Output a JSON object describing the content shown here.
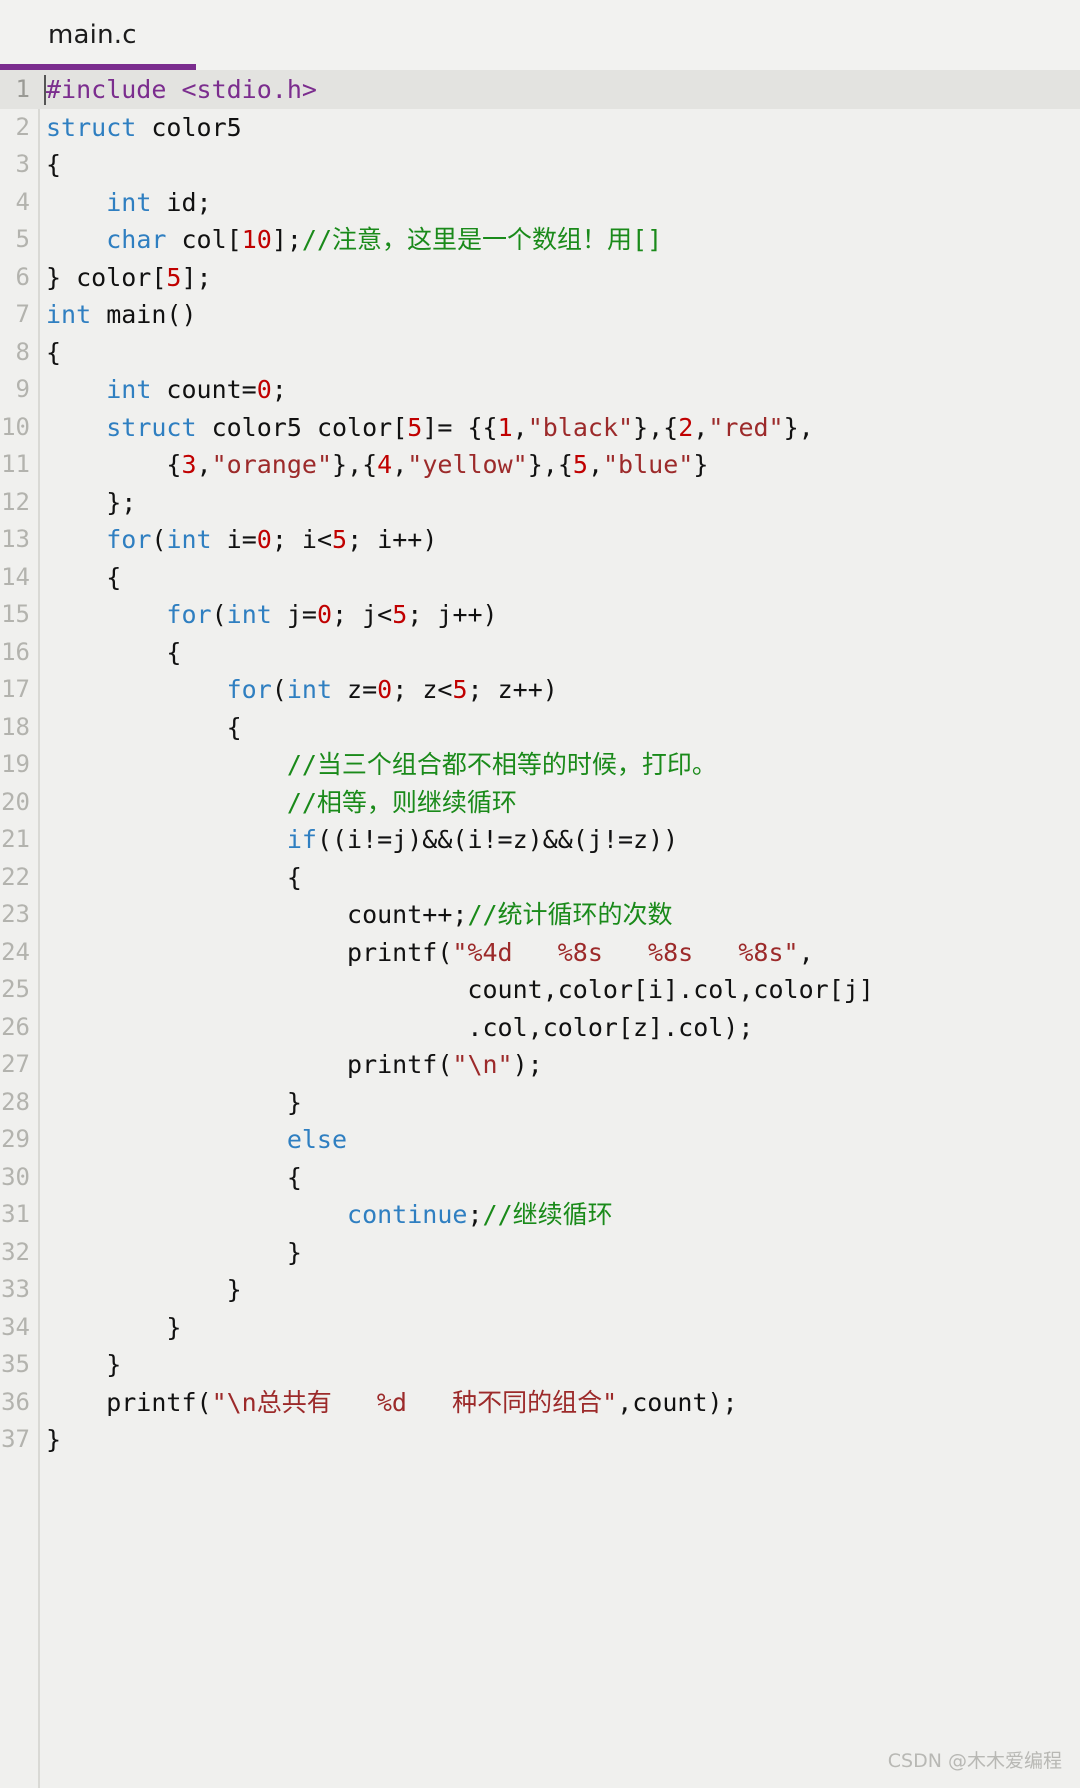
{
  "tab": {
    "label": "main.c",
    "accent_color": "#7b2d8e"
  },
  "editor": {
    "background_color": "#f0f0ee",
    "current_line": 1,
    "total_lines": 37,
    "colors": {
      "keyword": "#2f7fc1",
      "preprocessor": "#7b2d8e",
      "string": "#9c2a2a",
      "number": "#c00000",
      "comment": "#1a8a1a",
      "plain": "#111111",
      "gutter_text": "#b3b3ae"
    },
    "lines": [
      {
        "n": "1",
        "tokens": [
          {
            "t": "pre",
            "v": "#include <stdio.h>"
          }
        ]
      },
      {
        "n": "2",
        "tokens": [
          {
            "t": "kw",
            "v": "struct"
          },
          {
            "t": "pl",
            "v": " color5"
          }
        ]
      },
      {
        "n": "3",
        "tokens": [
          {
            "t": "pl",
            "v": "{"
          }
        ]
      },
      {
        "n": "4",
        "tokens": [
          {
            "t": "pl",
            "v": "    "
          },
          {
            "t": "kw",
            "v": "int"
          },
          {
            "t": "pl",
            "v": " id;"
          }
        ]
      },
      {
        "n": "5",
        "tokens": [
          {
            "t": "pl",
            "v": "    "
          },
          {
            "t": "kw",
            "v": "char"
          },
          {
            "t": "pl",
            "v": " col["
          },
          {
            "t": "num",
            "v": "10"
          },
          {
            "t": "pl",
            "v": "];"
          },
          {
            "t": "cmt",
            "v": "//注意，这里是一个数组！用[]"
          }
        ]
      },
      {
        "n": "6",
        "tokens": [
          {
            "t": "pl",
            "v": "} color["
          },
          {
            "t": "num",
            "v": "5"
          },
          {
            "t": "pl",
            "v": "];"
          }
        ]
      },
      {
        "n": "7",
        "tokens": [
          {
            "t": "kw",
            "v": "int"
          },
          {
            "t": "pl",
            "v": " main()"
          }
        ]
      },
      {
        "n": "8",
        "tokens": [
          {
            "t": "pl",
            "v": "{"
          }
        ]
      },
      {
        "n": "9",
        "tokens": [
          {
            "t": "pl",
            "v": "    "
          },
          {
            "t": "kw",
            "v": "int"
          },
          {
            "t": "pl",
            "v": " count="
          },
          {
            "t": "num",
            "v": "0"
          },
          {
            "t": "pl",
            "v": ";"
          }
        ]
      },
      {
        "n": "10",
        "tokens": [
          {
            "t": "pl",
            "v": "    "
          },
          {
            "t": "kw",
            "v": "struct"
          },
          {
            "t": "pl",
            "v": " color5 color["
          },
          {
            "t": "num",
            "v": "5"
          },
          {
            "t": "pl",
            "v": "]= {{"
          },
          {
            "t": "num",
            "v": "1"
          },
          {
            "t": "pl",
            "v": ","
          },
          {
            "t": "str",
            "v": "\"black\""
          },
          {
            "t": "pl",
            "v": "},{"
          },
          {
            "t": "num",
            "v": "2"
          },
          {
            "t": "pl",
            "v": ","
          },
          {
            "t": "str",
            "v": "\"red\""
          },
          {
            "t": "pl",
            "v": "},"
          }
        ]
      },
      {
        "n": "11",
        "tokens": [
          {
            "t": "pl",
            "v": "        {"
          },
          {
            "t": "num",
            "v": "3"
          },
          {
            "t": "pl",
            "v": ","
          },
          {
            "t": "str",
            "v": "\"orange\""
          },
          {
            "t": "pl",
            "v": "},{"
          },
          {
            "t": "num",
            "v": "4"
          },
          {
            "t": "pl",
            "v": ","
          },
          {
            "t": "str",
            "v": "\"yellow\""
          },
          {
            "t": "pl",
            "v": "},{"
          },
          {
            "t": "num",
            "v": "5"
          },
          {
            "t": "pl",
            "v": ","
          },
          {
            "t": "str",
            "v": "\"blue\""
          },
          {
            "t": "pl",
            "v": "}"
          }
        ]
      },
      {
        "n": "12",
        "tokens": [
          {
            "t": "pl",
            "v": "    };"
          }
        ]
      },
      {
        "n": "13",
        "tokens": [
          {
            "t": "pl",
            "v": "    "
          },
          {
            "t": "kw",
            "v": "for"
          },
          {
            "t": "pl",
            "v": "("
          },
          {
            "t": "kw",
            "v": "int"
          },
          {
            "t": "pl",
            "v": " i="
          },
          {
            "t": "num",
            "v": "0"
          },
          {
            "t": "pl",
            "v": "; i<"
          },
          {
            "t": "num",
            "v": "5"
          },
          {
            "t": "pl",
            "v": "; i++)"
          }
        ]
      },
      {
        "n": "14",
        "tokens": [
          {
            "t": "pl",
            "v": "    {"
          }
        ]
      },
      {
        "n": "15",
        "tokens": [
          {
            "t": "pl",
            "v": "        "
          },
          {
            "t": "kw",
            "v": "for"
          },
          {
            "t": "pl",
            "v": "("
          },
          {
            "t": "kw",
            "v": "int"
          },
          {
            "t": "pl",
            "v": " j="
          },
          {
            "t": "num",
            "v": "0"
          },
          {
            "t": "pl",
            "v": "; j<"
          },
          {
            "t": "num",
            "v": "5"
          },
          {
            "t": "pl",
            "v": "; j++)"
          }
        ]
      },
      {
        "n": "16",
        "tokens": [
          {
            "t": "pl",
            "v": "        {"
          }
        ]
      },
      {
        "n": "17",
        "tokens": [
          {
            "t": "pl",
            "v": "            "
          },
          {
            "t": "kw",
            "v": "for"
          },
          {
            "t": "pl",
            "v": "("
          },
          {
            "t": "kw",
            "v": "int"
          },
          {
            "t": "pl",
            "v": " z="
          },
          {
            "t": "num",
            "v": "0"
          },
          {
            "t": "pl",
            "v": "; z<"
          },
          {
            "t": "num",
            "v": "5"
          },
          {
            "t": "pl",
            "v": "; z++)"
          }
        ]
      },
      {
        "n": "18",
        "tokens": [
          {
            "t": "pl",
            "v": "            {"
          }
        ]
      },
      {
        "n": "19",
        "tokens": [
          {
            "t": "pl",
            "v": "                "
          },
          {
            "t": "cmt",
            "v": "//当三个组合都不相等的时候，打印。"
          }
        ]
      },
      {
        "n": "20",
        "tokens": [
          {
            "t": "pl",
            "v": "                "
          },
          {
            "t": "cmt",
            "v": "//相等，则继续循环"
          }
        ]
      },
      {
        "n": "21",
        "tokens": [
          {
            "t": "pl",
            "v": "                "
          },
          {
            "t": "kw",
            "v": "if"
          },
          {
            "t": "pl",
            "v": "((i!=j)&&(i!=z)&&(j!=z))"
          }
        ]
      },
      {
        "n": "22",
        "tokens": [
          {
            "t": "pl",
            "v": "                {"
          }
        ]
      },
      {
        "n": "23",
        "tokens": [
          {
            "t": "pl",
            "v": "                    count++;"
          },
          {
            "t": "cmt",
            "v": "//统计循环的次数"
          }
        ]
      },
      {
        "n": "24",
        "tokens": [
          {
            "t": "pl",
            "v": "                    printf("
          },
          {
            "t": "str",
            "v": "\"%4d   %8s   %8s   %8s\""
          },
          {
            "t": "pl",
            "v": ","
          }
        ]
      },
      {
        "n": "25",
        "tokens": [
          {
            "t": "pl",
            "v": "                            count,color[i].col,color[j]"
          }
        ]
      },
      {
        "n": "26",
        "tokens": [
          {
            "t": "pl",
            "v": "                            .col,color[z].col);"
          }
        ]
      },
      {
        "n": "27",
        "tokens": [
          {
            "t": "pl",
            "v": "                    printf("
          },
          {
            "t": "str",
            "v": "\"\\n\""
          },
          {
            "t": "pl",
            "v": ");"
          }
        ]
      },
      {
        "n": "28",
        "tokens": [
          {
            "t": "pl",
            "v": "                }"
          }
        ]
      },
      {
        "n": "29",
        "tokens": [
          {
            "t": "pl",
            "v": "                "
          },
          {
            "t": "kw",
            "v": "else"
          }
        ]
      },
      {
        "n": "30",
        "tokens": [
          {
            "t": "pl",
            "v": "                {"
          }
        ]
      },
      {
        "n": "31",
        "tokens": [
          {
            "t": "pl",
            "v": "                    "
          },
          {
            "t": "kw",
            "v": "continue"
          },
          {
            "t": "pl",
            "v": ";"
          },
          {
            "t": "cmt",
            "v": "//继续循环"
          }
        ]
      },
      {
        "n": "32",
        "tokens": [
          {
            "t": "pl",
            "v": "                }"
          }
        ]
      },
      {
        "n": "33",
        "tokens": [
          {
            "t": "pl",
            "v": "            }"
          }
        ]
      },
      {
        "n": "34",
        "tokens": [
          {
            "t": "pl",
            "v": "        }"
          }
        ]
      },
      {
        "n": "35",
        "tokens": [
          {
            "t": "pl",
            "v": "    }"
          }
        ]
      },
      {
        "n": "36",
        "tokens": [
          {
            "t": "pl",
            "v": "    printf("
          },
          {
            "t": "str",
            "v": "\"\\n总共有   %d   种不同的组合\""
          },
          {
            "t": "pl",
            "v": ",count);"
          }
        ]
      },
      {
        "n": "37",
        "tokens": [
          {
            "t": "pl",
            "v": "}"
          }
        ]
      }
    ]
  },
  "watermark": {
    "text": "CSDN @木木爱编程"
  }
}
